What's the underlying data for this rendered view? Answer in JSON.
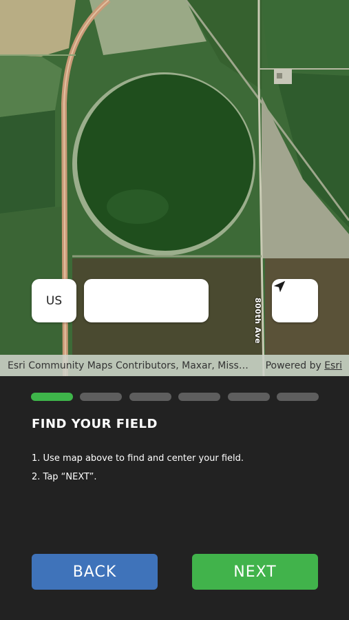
{
  "map": {
    "road_label": "800th Ave",
    "attribution": "Esri Community Maps Contributors, Maxar, Miss…",
    "powered_by_prefix": "Powered by",
    "powered_by_link": "Esri"
  },
  "controls": {
    "country_code": "US",
    "search_value": "",
    "search_placeholder": ""
  },
  "progress": {
    "total_steps": 6,
    "current_step": 1
  },
  "panel": {
    "title": "FIND YOUR FIELD",
    "steps": [
      "1.  Use map above to find and center your field.",
      "2.  Tap “NEXT”."
    ]
  },
  "buttons": {
    "back": "BACK",
    "next": "NEXT"
  },
  "colors": {
    "accent_green": "#3eb54a",
    "back_blue": "#3f73ba",
    "background": "#222222",
    "inactive_segment": "#5e5e5e"
  },
  "icons": {
    "locate": "navigation-arrow-icon"
  }
}
